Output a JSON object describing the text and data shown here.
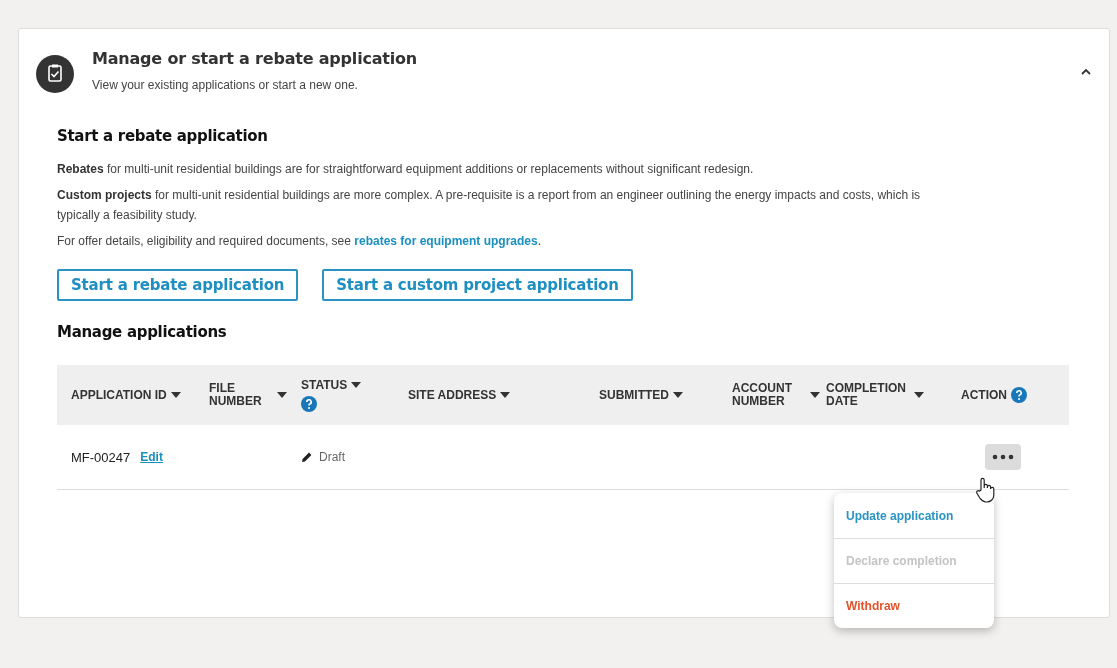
{
  "panel": {
    "title": "Manage or start a rebate application",
    "subtitle": "View your existing applications or start a new one.",
    "expanded": true
  },
  "start_section": {
    "heading": "Start a rebate application",
    "paragraphs": [
      {
        "text": "**Rebates** for multi-unit residential buildings are for straightforward equipment additions or replacements without significant redesign."
      },
      {
        "text": "**Custom projects** for multi-unit residential buildings are more complex. A pre-requisite is a report from an engineer outlining the energy impacts and costs, which is typically a feasibility study."
      },
      {
        "text": "For offer details, eligibility and required documents, see ",
        "link": "rebates for equipment upgrades",
        "after": "."
      }
    ],
    "buttons": [
      "Start a rebate application",
      "Start a custom project application"
    ]
  },
  "manage_section": {
    "heading": "Manage applications",
    "table": {
      "columns": [
        {
          "label": "APPLICATION ID",
          "sortable": true,
          "help": false
        },
        {
          "label": "FILE NUMBER",
          "sortable": true,
          "help": false
        },
        {
          "label": "STATUS",
          "sortable": true,
          "help": true
        },
        {
          "label": "SITE ADDRESS",
          "sortable": true,
          "help": false
        },
        {
          "label": "SUBMITTED",
          "sortable": true,
          "help": false
        },
        {
          "label": "ACCOUNT NUMBER",
          "sortable": true,
          "help": false
        },
        {
          "label": "COMPLETION DATE",
          "sortable": true,
          "help": false
        },
        {
          "label": "ACTION",
          "sortable": false,
          "help": true
        }
      ],
      "rows": [
        {
          "application_id": "MF-00247",
          "edit_link": "Edit",
          "status": "Draft",
          "menu_open": true
        }
      ]
    },
    "action_menu": [
      {
        "label": "Update application",
        "kind": "link"
      },
      {
        "label": "Declare completion",
        "kind": "disabled"
      },
      {
        "label": "Withdraw",
        "kind": "danger"
      }
    ]
  }
}
